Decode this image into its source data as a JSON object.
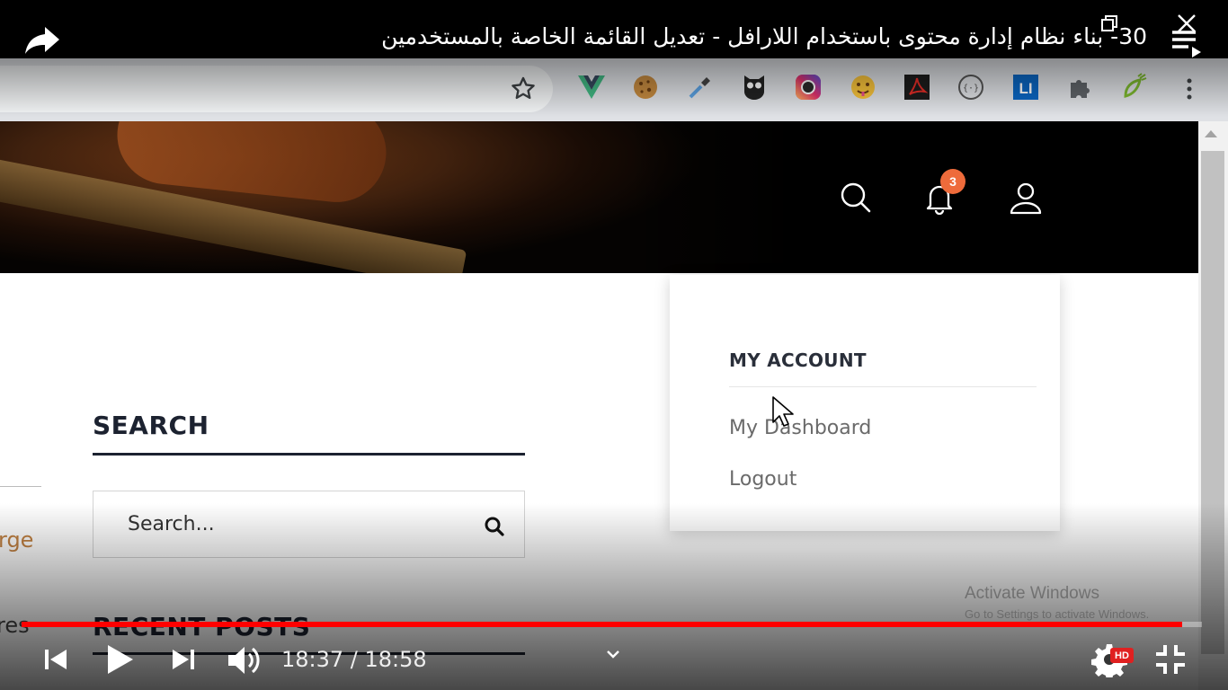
{
  "player": {
    "title": "30- بناء نظام إدارة محتوى باستخدام اللارافل - تعديل القائمة الخاصة بالمستخدمين",
    "current_time": "18:37",
    "duration": "18:58",
    "time_display": "18:37 / 18:58",
    "progress_fraction": 0.983,
    "hd_label": "HD",
    "accent_color": "#ff0000"
  },
  "browser": {
    "extensions": [
      "vue-devtools-icon",
      "cookie-icon",
      "color-picker-icon",
      "owl-icon",
      "camera-icon",
      "emoji-icon",
      "pdf-icon",
      "json-icon",
      "linkedin-icon",
      "puzzle-icon",
      "leaf-icon"
    ]
  },
  "site_header": {
    "notification_count": "3",
    "badge_color": "#ee6b3b"
  },
  "account_menu": {
    "heading": "MY ACCOUNT",
    "items": [
      {
        "label": "My Dashboard"
      },
      {
        "label": "Logout"
      }
    ]
  },
  "sidebar": {
    "search_heading": "SEARCH",
    "search_placeholder": "Search...",
    "recent_posts_heading": "RECENT POSTS",
    "partial_links": [
      "rge",
      "res"
    ]
  },
  "os_watermark": {
    "line1": "Activate Windows",
    "line2": "Go to Settings to activate Windows."
  }
}
